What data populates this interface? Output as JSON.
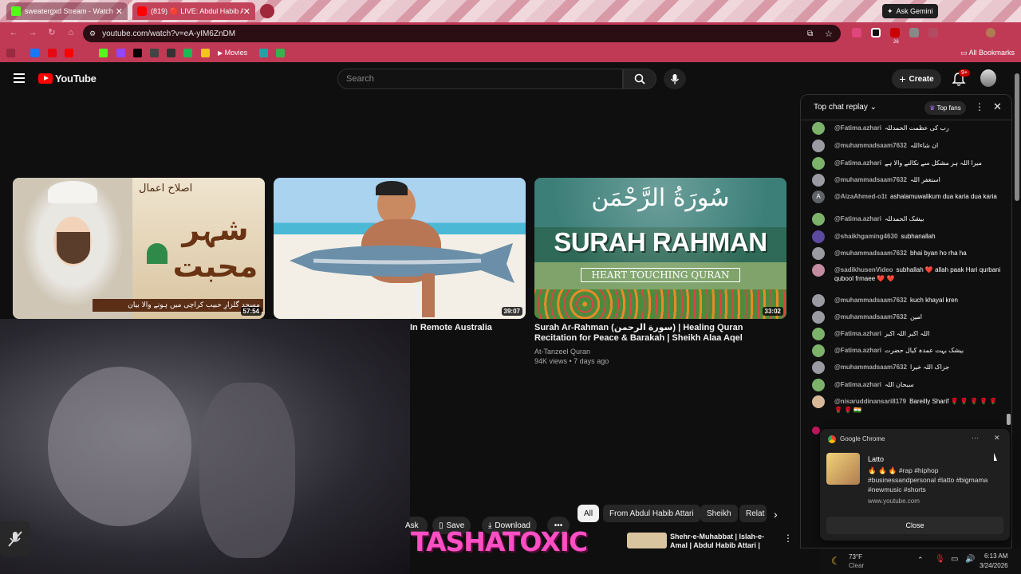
{
  "browser": {
    "tabs": [
      {
        "title": "sweatergxd Stream - Watch Liv"
      },
      {
        "title": "(819) 🔴 LIVE: Abdul Habib Att"
      }
    ],
    "gemini_label": "Ask Gemini",
    "url": "youtube.com/watch?v=eA-yIM6ZnDM",
    "bookmarks": {
      "movies": "Movies",
      "all": "All Bookmarks"
    },
    "ext_badge": "26"
  },
  "youtube": {
    "logo": "YouTube",
    "search_placeholder": "Search",
    "create_label": "Create",
    "notif_count": "9+"
  },
  "videos": [
    {
      "duration": "57:54",
      "thumb_text_top": "اصلاح اعمال",
      "thumb_text_main": "شہر محبت",
      "thumb_text_bottom": "مسجد گلزارِ حبیب کراچی میں ہونے والا بیان"
    },
    {
      "duration": "39:07",
      "title_fragment": "In Remote Australia"
    },
    {
      "duration": "33:02",
      "thumb_arabic": "سُورَةُ الرَّحْمَن",
      "thumb_title": "SURAH RAHMAN",
      "thumb_subtitle": "HEART TOUCHING QURAN",
      "title": "Surah Ar-Rahman (سورة الرحمن) | Healing Quran Recitation for Peace & Barakah | Sheikh Alaa Aqel",
      "channel": "At-Tanzeel Quran",
      "meta": "94K views • 7 days ago"
    }
  ],
  "actions": {
    "ask": "Ask",
    "save": "Save",
    "download": "Download",
    "more": "•••"
  },
  "chips": [
    "All",
    "From Abdul Habib Attari",
    "Sheikh",
    "Relat"
  ],
  "next_video": {
    "title": "Shehr-e-Muhabbat | Islah-e-Amal | Abdul Habib Attari |"
  },
  "overlay_brand": "TASHATOXIC",
  "chat": {
    "title": "Top chat replay",
    "top_fans": "Top fans",
    "messages": [
      {
        "author": "@Fatima.azhari",
        "text": "رب کی عظمت الحمدللہ",
        "color": "#7cb26a"
      },
      {
        "author": "@muhammadsaam7632",
        "text": "ان شاءاللہ",
        "color": "#9a9aa2"
      },
      {
        "author": "@Fatima.azhari",
        "text": "میرا اللہ ہر مشکل سے نکالنے والا ہے",
        "color": "#7cb26a"
      },
      {
        "author": "@muhammadsaam7632",
        "text": "استغفر اللہ",
        "color": "#9a9aa2"
      },
      {
        "author": "@AizaAhmed-o1t",
        "text": "ashalamuwalikum dua karia dua karia",
        "color": "#5f6368",
        "initial": "A"
      },
      {
        "author": "@Fatima.azhari",
        "text": "بیشک الحمدللہ",
        "color": "#7cb26a"
      },
      {
        "author": "@shaikhgaming4630",
        "text": "subhanallah",
        "color": "#5b4aa0"
      },
      {
        "author": "@muhammadsaam7632",
        "text": "bhai byan ho rha ha",
        "color": "#9a9aa2"
      },
      {
        "author": "@sadikhusenVideo",
        "text": "subhallah ❤️ allah paak Hari qurbani qubool frmaee ❤️ ❤️",
        "color": "#c48aa0"
      },
      {
        "author": "@muhammadsaam7632",
        "text": "kuch khayal kren",
        "color": "#9a9aa2"
      },
      {
        "author": "@muhammadsaam7632",
        "text": "امین",
        "color": "#9a9aa2"
      },
      {
        "author": "@Fatima.azhari",
        "text": "اللہ اکبر اللہ اکبر",
        "color": "#7cb26a"
      },
      {
        "author": "@Fatima.azhari",
        "text": "بیشک بہت عمدہ کیال حضرت",
        "color": "#7cb26a"
      },
      {
        "author": "@muhammadsaam7632",
        "text": "جزاک اللہ خیرا",
        "color": "#9a9aa2"
      },
      {
        "author": "@Fatima.azhari",
        "text": "سبحان اللہ",
        "color": "#7cb26a"
      },
      {
        "author": "@nisaruddinansari8179",
        "text": "Bareilly Sharif 🌹 🌹 🌹 🌹 🌹 🌹 🌹 🇮🇳",
        "color": "#d9b89a"
      }
    ]
  },
  "chrome_notification": {
    "app": "Google Chrome",
    "title": "Latto",
    "body": "🔥 🔥 🔥 #rap #hiphop #businessandpersonal #latto #bigmama #newmusic #shorts",
    "source": "www.youtube.com",
    "close_label": "Close"
  },
  "taskbar": {
    "temp": "73°F",
    "weather": "Clear",
    "time": "6:13 AM",
    "date": "3/24/2026"
  },
  "colors": {
    "yt_red": "#ff0000",
    "chrome_accent": "#c03a56",
    "brand_pink": "#ff4fc4"
  }
}
